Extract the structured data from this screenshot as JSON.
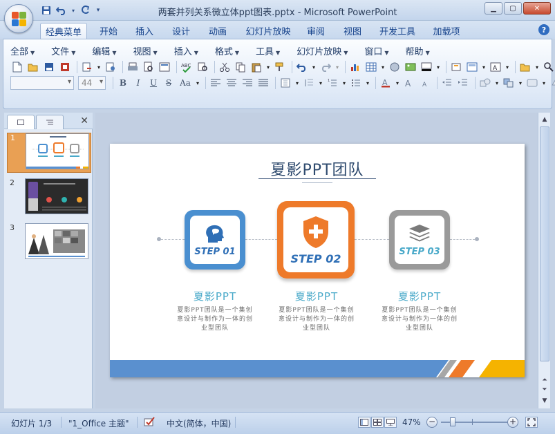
{
  "window": {
    "title": "两套并列关系微立体ppt图表.pptx - Microsoft PowerPoint"
  },
  "ribbon_tabs": [
    {
      "label": "经典菜单",
      "active": true
    },
    {
      "label": "开始"
    },
    {
      "label": "插入"
    },
    {
      "label": "设计"
    },
    {
      "label": "动画"
    },
    {
      "label": "幻灯片放映"
    },
    {
      "label": "审阅"
    },
    {
      "label": "视图"
    },
    {
      "label": "开发工具"
    },
    {
      "label": "加载项"
    }
  ],
  "menus": [
    "全部",
    "文件",
    "编辑",
    "视图",
    "插入",
    "格式",
    "工具",
    "幻灯片放映",
    "窗口",
    "帮助"
  ],
  "font": {
    "name_value": "",
    "size_value": "44"
  },
  "format_buttons": {
    "bold": "B",
    "italic": "I",
    "underline": "U",
    "strike": "S",
    "case": "Aa"
  },
  "slides_panel": {
    "slides": [
      {
        "number": "1",
        "selected": true
      },
      {
        "number": "2"
      },
      {
        "number": "3"
      }
    ]
  },
  "slide": {
    "title": "夏影PPT团队",
    "steps": [
      {
        "label": "STEP 01",
        "color": "#4a8fd0",
        "title": "夏影PPT",
        "desc": "夏影PPT团队是一个集创意设计与制作为一体的创业型团队",
        "icon": "head-speech-icon"
      },
      {
        "label": "STEP 02",
        "color": "#ee7a2a",
        "title": "夏影PPT",
        "desc": "夏影PPT团队是一个集创意设计与制作为一体的创业型团队",
        "icon": "shield-plus-icon"
      },
      {
        "label": "STEP 03",
        "color": "#9a9a9a",
        "title": "夏影PPT",
        "desc": "夏影PPT团队是一个集创意设计与制作为一体的创业型团队",
        "icon": "layers-icon"
      }
    ],
    "colors": {
      "step_text": "#49a9c9",
      "band_blue": "#5a90cf",
      "band_orange": "#ee7a2a",
      "band_gray": "#a7a7a7",
      "band_yellow": "#f5b300"
    }
  },
  "status": {
    "slide_info": "幻灯片 1/3",
    "theme": "\"1_Office 主题\"",
    "language": "中文(简体，中国)",
    "zoom": "47%"
  }
}
